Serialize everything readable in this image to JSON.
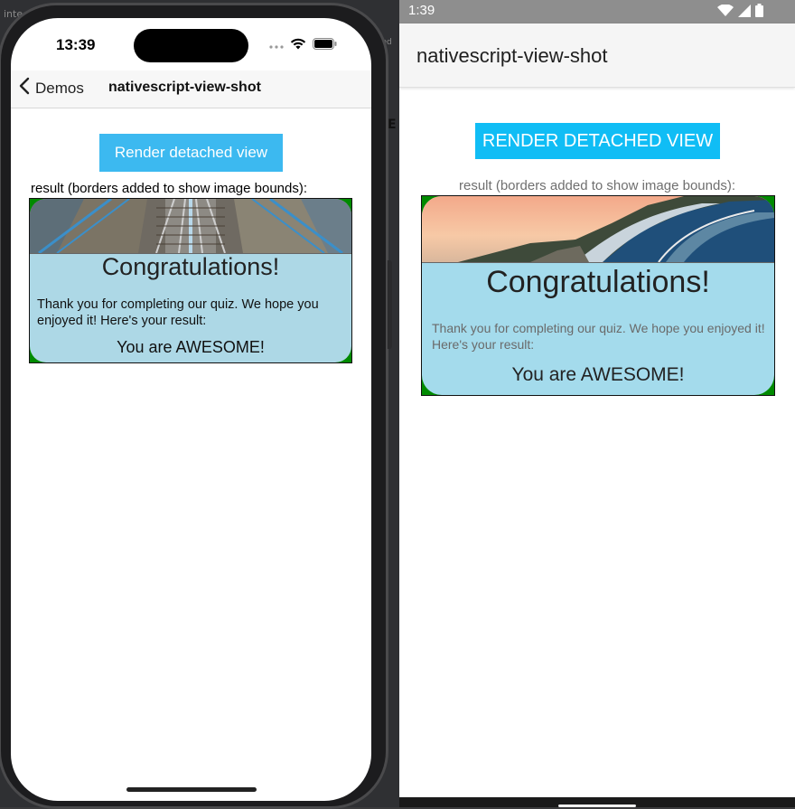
{
  "desktop": {
    "frag_top": "inte",
    "frag_right": "ied",
    "frag_e": "E"
  },
  "ios": {
    "time": "13:39",
    "back_label": "Demos",
    "title": "nativescript-view-shot",
    "button_label": "Render detached view",
    "result_label": "result (borders added to show image bounds):",
    "card": {
      "heading": "Congratulations!",
      "message": "Thank you for completing our quiz. We hope you enjoyed it! Here's your result:",
      "result": "You are AWESOME!"
    }
  },
  "android": {
    "time": "1:39",
    "title": "nativescript-view-shot",
    "button_label": "RENDER DETACHED VIEW",
    "result_label": "result (borders added to show image bounds):",
    "card": {
      "heading": "Congratulations!",
      "message": "Thank you for completing our quiz. We hope you enjoyed it! Here's your result:",
      "result": "You are AWESOME!"
    }
  },
  "colors": {
    "ios_button": "#3cb9f0",
    "android_button": "#10bdf5",
    "card_background": "#add8e6",
    "image_bounds_border": "#008a00"
  },
  "icons": [
    "wifi-icon",
    "battery-icon",
    "cellular-icon",
    "back-chevron-icon"
  ]
}
